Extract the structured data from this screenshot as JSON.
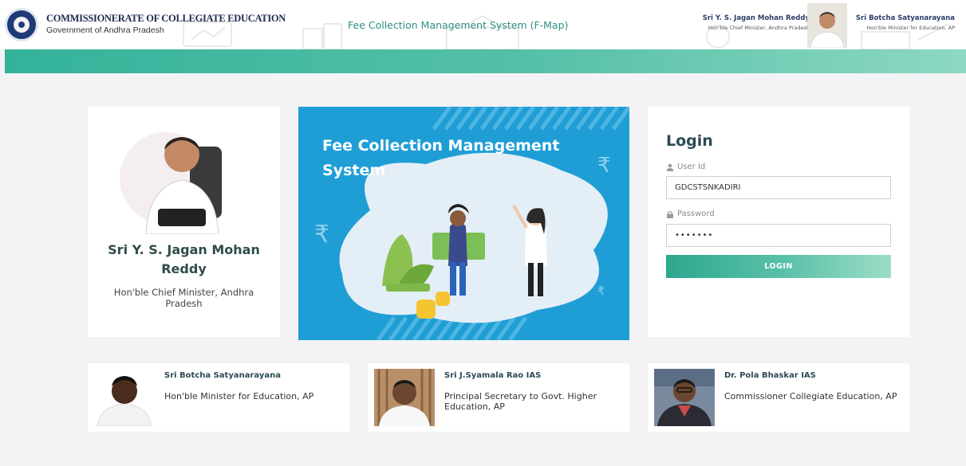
{
  "header": {
    "org_title": "COMMISSIONERATE OF COLLEGIATE EDUCATION",
    "org_subtitle": "Government of Andhra Pradesh",
    "app_title": "Fee Collection Management System (F-Map)",
    "cm_name": "Sri Y. S. Jagan Mohan Reddy",
    "cm_role": "Hon'ble Chief Minister, Andhra Pradesh",
    "minister_name": "Sri Botcha Satyanarayana",
    "minister_role": "Hon'ble Minister for Education, AP"
  },
  "cm_card": {
    "name": "Sri Y. S. Jagan Mohan Reddy",
    "role": "Hon'ble Chief Minister, Andhra Pradesh"
  },
  "hero": {
    "title": "Fee Collection Management System"
  },
  "login": {
    "title": "Login",
    "user_label": "User Id",
    "user_value": "GDCSTSNKADIRI",
    "password_label": "Password",
    "password_value": "•••••••",
    "button_label": "LOGIN"
  },
  "officials": [
    {
      "name": "Sri Botcha Satyanarayana",
      "role": "Hon'ble Minister for Education, AP"
    },
    {
      "name": "Sri J.Syamala Rao IAS",
      "role": "Principal Secretary to Govt. Higher Education, AP"
    },
    {
      "name": "Dr. Pola Bhaskar IAS",
      "role": "Commissioner Collegiate Education, AP"
    }
  ],
  "icons": [
    "user-icon",
    "lock-icon",
    "rupee-icon"
  ],
  "colors": {
    "accent": "#33b39a",
    "hero_bg": "#1f9ed6",
    "heading": "#2b4b55"
  }
}
